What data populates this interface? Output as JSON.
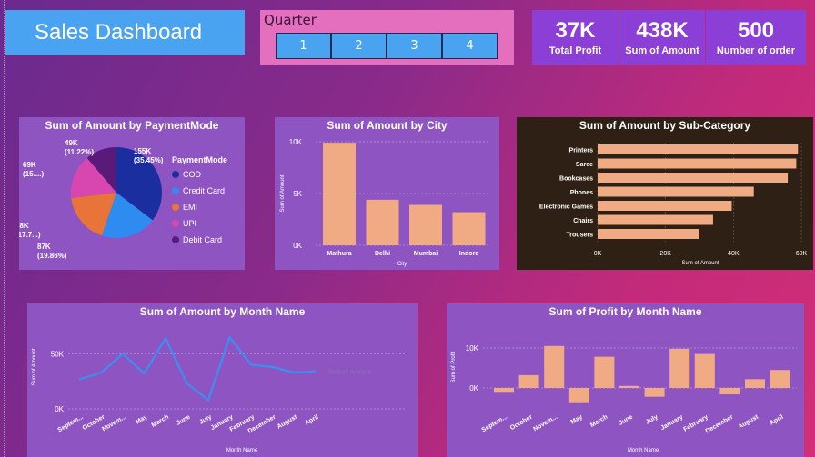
{
  "header": {
    "title": "Sales Dashboard"
  },
  "slicer": {
    "label": "Quarter",
    "options": [
      "1",
      "2",
      "3",
      "4"
    ]
  },
  "kpis": [
    {
      "value": "37K",
      "label": "Total Profit"
    },
    {
      "value": "438K",
      "label": "Sum of Amount"
    },
    {
      "value": "500",
      "label": "Number of order"
    }
  ],
  "colors": {
    "bar": "#f0ab85",
    "line": "#3a8ff0",
    "panel": "#8e55c2",
    "dark_panel": "#2e2014"
  },
  "chart_data": [
    {
      "type": "pie",
      "title": "Sum of Amount by PaymentMode",
      "legend_title": "PaymentMode",
      "categories": [
        "COD",
        "Credit Card",
        "EMI",
        "UPI",
        "Debit Card"
      ],
      "values": [
        155,
        87,
        78,
        69,
        49
      ],
      "colors": [
        "#1a2ea0",
        "#2e8cf0",
        "#e9743a",
        "#d846b0",
        "#5a1a7a"
      ],
      "data_labels": [
        "155K (35.45%)",
        "87K (19.86%)",
        "78K (17.7...)",
        "69K (15....)",
        "49K (11.22%)"
      ],
      "legend_placement": "right"
    },
    {
      "type": "bar",
      "title": "Sum of Amount by City",
      "categories": [
        "Mathura",
        "Delhi",
        "Mumbai",
        "Indore"
      ],
      "values": [
        9900,
        4400,
        3900,
        3200
      ],
      "xlabel": "City",
      "ylabel": "Sum of Amount",
      "yticks": [
        "0K",
        "5K",
        "10K"
      ],
      "ylim": [
        0,
        10000
      ]
    },
    {
      "type": "bar",
      "orientation": "horizontal",
      "title": "Sum of Amount by Sub-Category",
      "categories": [
        "Printers",
        "Saree",
        "Bookcases",
        "Phones",
        "Electronic Games",
        "Chairs",
        "Trousers"
      ],
      "values": [
        59000,
        58500,
        56000,
        46000,
        39500,
        34000,
        30000
      ],
      "xlabel": "Sum of Amount",
      "xticks": [
        "0K",
        "20K",
        "40K",
        "60K"
      ],
      "xlim": [
        0,
        60000
      ]
    },
    {
      "type": "line",
      "title": "Sum of Amount by Month Name",
      "categories": [
        "September",
        "October",
        "November",
        "May",
        "March",
        "June",
        "July",
        "January",
        "February",
        "December",
        "August",
        "April"
      ],
      "tick_labels": [
        "Septem...",
        "October",
        "Novem...",
        "May",
        "March",
        "June",
        "July",
        "January",
        "February",
        "December",
        "August",
        "April"
      ],
      "values": [
        27000,
        33000,
        50000,
        32000,
        64000,
        23000,
        8000,
        65000,
        40000,
        38000,
        33000,
        34000
      ],
      "xlabel": "Month Name",
      "ylabel": "Sum of Amount",
      "series_label": "Sum of Amount",
      "yticks": [
        "0K",
        "50K"
      ],
      "ylim": [
        0,
        75000
      ]
    },
    {
      "type": "bar",
      "title": "Sum of Profit by Month Name",
      "categories": [
        "September",
        "October",
        "November",
        "May",
        "March",
        "June",
        "July",
        "January",
        "February",
        "December",
        "August",
        "April"
      ],
      "tick_labels": [
        "Septem...",
        "October",
        "Novem...",
        "May",
        "March",
        "June",
        "July",
        "January",
        "February",
        "December",
        "August",
        "April"
      ],
      "values": [
        -1200,
        3200,
        10500,
        -3800,
        7800,
        500,
        -2200,
        9800,
        8500,
        -1600,
        2200,
        4500
      ],
      "xlabel": "Month Name",
      "ylabel": "Sum of Profit",
      "yticks": [
        "0K",
        "10K"
      ],
      "ylim": [
        -5000,
        12000
      ]
    }
  ]
}
